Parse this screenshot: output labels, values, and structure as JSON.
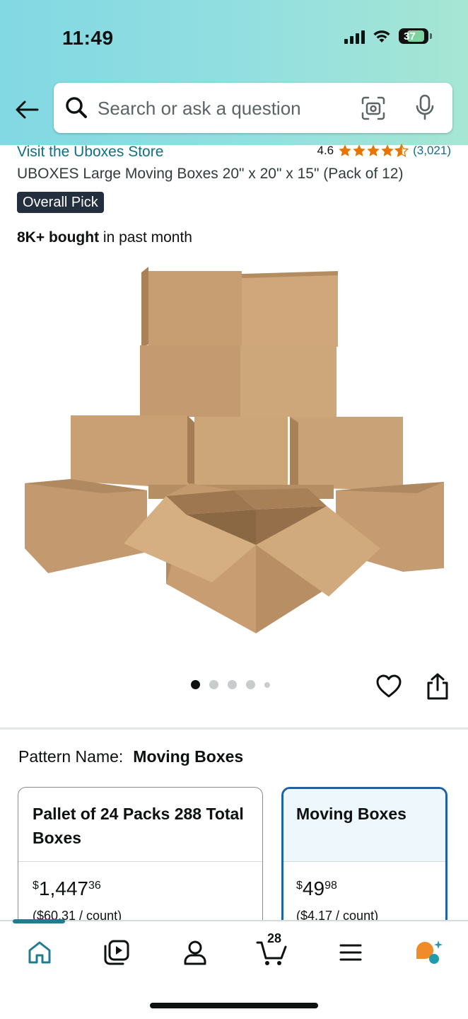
{
  "status_bar": {
    "time": "11:49",
    "battery": "37",
    "icons": [
      "signal-icon",
      "wifi-icon",
      "battery-icon"
    ]
  },
  "search": {
    "placeholder": "Search or ask a question",
    "value": ""
  },
  "product": {
    "store_link": "Visit the Uboxes Store",
    "rating": "4.6",
    "rating_count": "(3,021)",
    "stars": 4.6,
    "title": "UBOXES Large Moving Boxes 20\" x 20\" x 15\" (Pack of 12)",
    "badge": "Overall Pick",
    "bought_bold": "8K+ bought",
    "bought_rest": " in past month"
  },
  "gallery": {
    "image_count": 5,
    "active_index": 0
  },
  "pattern": {
    "label": "Pattern Name:",
    "value": "Moving Boxes"
  },
  "options": [
    {
      "title": "Pallet of 24 Packs 288 Total Boxes",
      "currency": "$",
      "whole": "1,447",
      "cents": "36",
      "unit_price": "($60.31 / count)",
      "selected": false
    },
    {
      "title": "Moving Boxes",
      "currency": "$",
      "whole": "49",
      "cents": "98",
      "unit_price": "($4.17 / count)",
      "selected": true
    }
  ],
  "bottom_nav": {
    "items": [
      "home-icon",
      "video-icon",
      "account-icon",
      "cart-icon",
      "menu-icon",
      "rufus-icon"
    ],
    "cart_count": "28",
    "active": "home"
  },
  "colors": {
    "header_start": "#82d8e3",
    "header_end": "#a6e6d3",
    "link": "#0e6f88",
    "star": "#e77600",
    "selected_border": "#2162a1",
    "badge_bg": "#232f3e",
    "nav_active": "#1f7d8f"
  }
}
